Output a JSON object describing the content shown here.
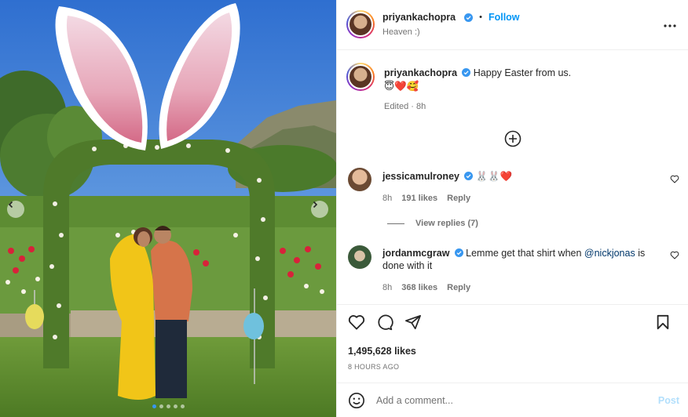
{
  "post": {
    "author": "priyankachopra",
    "follow_label": "Follow",
    "location": "Heaven :)",
    "more_icon": "more-horizontal-icon"
  },
  "caption": {
    "author": "priyankachopra",
    "text": "Happy Easter from us.",
    "emojis": "😇❤️🥰",
    "edited": "Edited · 8h"
  },
  "load_more_icon": "plus-circle-icon",
  "comments": [
    {
      "author": "jessicamulroney",
      "text": "🐰🐰❤️",
      "time": "8h",
      "likes": "191 likes",
      "reply_label": "Reply",
      "view_replies": "View replies (7)"
    },
    {
      "author": "jordanmcgraw",
      "text_before": "Lemme get that shirt when ",
      "mention": "@nickjonas",
      "text_after": " is done with it",
      "time": "8h",
      "likes": "368 likes",
      "reply_label": "Reply"
    }
  ],
  "actions": {
    "like_icon": "heart-icon",
    "comment_icon": "comment-icon",
    "share_icon": "send-icon",
    "save_icon": "bookmark-icon"
  },
  "stats": {
    "likes": "1,495,628 likes",
    "posted": "8 HOURS AGO"
  },
  "comment_box": {
    "placeholder": "Add a comment...",
    "post_label": "Post"
  },
  "carousel": {
    "count": 5,
    "active_index": 0
  },
  "colors": {
    "accent": "#0095f6",
    "verified": "#3897f0",
    "like_red": "#ed4956"
  }
}
